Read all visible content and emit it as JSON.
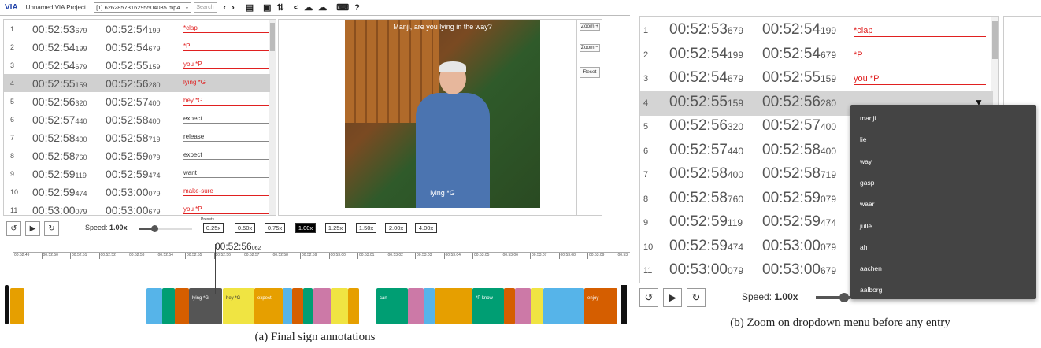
{
  "panel_a": {
    "topbar": {
      "brand": "VIA",
      "project": "Unnamed VIA Project",
      "file": "[1] 6262857316295504035.mp4",
      "search_placeholder": "Search"
    },
    "rows": [
      {
        "idx": "1",
        "s_main": "00:52:53",
        "s_ms": "679",
        "e_main": "00:52:54",
        "e_ms": "199",
        "label": "*clap",
        "red": true
      },
      {
        "idx": "2",
        "s_main": "00:52:54",
        "s_ms": "199",
        "e_main": "00:52:54",
        "e_ms": "679",
        "label": "*P",
        "red": true
      },
      {
        "idx": "3",
        "s_main": "00:52:54",
        "s_ms": "679",
        "e_main": "00:52:55",
        "e_ms": "159",
        "label": "you *P",
        "red": true
      },
      {
        "idx": "4",
        "s_main": "00:52:55",
        "s_ms": "159",
        "e_main": "00:52:56",
        "e_ms": "280",
        "label": "lying *G",
        "red": true
      },
      {
        "idx": "5",
        "s_main": "00:52:56",
        "s_ms": "320",
        "e_main": "00:52:57",
        "e_ms": "400",
        "label": "hey *G",
        "red": true
      },
      {
        "idx": "6",
        "s_main": "00:52:57",
        "s_ms": "440",
        "e_main": "00:52:58",
        "e_ms": "400",
        "label": "expect",
        "red": false
      },
      {
        "idx": "7",
        "s_main": "00:52:58",
        "s_ms": "400",
        "e_main": "00:52:58",
        "e_ms": "719",
        "label": "release",
        "red": false
      },
      {
        "idx": "8",
        "s_main": "00:52:58",
        "s_ms": "760",
        "e_main": "00:52:59",
        "e_ms": "079",
        "label": "expect",
        "red": false
      },
      {
        "idx": "9",
        "s_main": "00:52:59",
        "s_ms": "119",
        "e_main": "00:52:59",
        "e_ms": "474",
        "label": "want",
        "red": false
      },
      {
        "idx": "10",
        "s_main": "00:52:59",
        "s_ms": "474",
        "e_main": "00:53:00",
        "e_ms": "079",
        "label": "make-sure",
        "red": true
      },
      {
        "idx": "11",
        "s_main": "00:53:00",
        "s_ms": "079",
        "e_main": "00:53:00",
        "e_ms": "679",
        "label": "you *P",
        "red": true
      }
    ],
    "selected_row_index": 3,
    "video": {
      "caption_top": "Manji, are you lying in the way?",
      "caption_bottom": "lying *G"
    },
    "zoom": {
      "zoom_in": "Zoom +",
      "zoom_out": "Zoom −",
      "reset": "Reset"
    },
    "controls": {
      "speed_label": "Speed:",
      "speed_value": "1.00x",
      "speed_fraction": 0.3,
      "presets_label": "Presets",
      "presets": [
        "0.25x",
        "0.50x",
        "0.75x",
        "1.00x",
        "1.25x",
        "1.50x",
        "2.00x",
        "4.00x"
      ],
      "active_preset": "1.00x"
    },
    "timeline": {
      "current_main": "00:52:56",
      "current_ms": "062",
      "ticks": [
        "00:52:49",
        "00:52:50",
        "00:52:51",
        "00:52:52",
        "00:52:53",
        "00:52:54",
        "00:52:55",
        "00:52:56",
        "00:52:57",
        "00:52:58",
        "00:52:59",
        "00:53:00",
        "00:53:01",
        "00:53:02",
        "00:53:03",
        "00:53:04",
        "00:53:05",
        "00:53:06",
        "00:53:07",
        "00:53:08",
        "00:53:09",
        "00:53:"
      ],
      "segments": [
        {
          "label": "",
          "color": "#111111"
        },
        {
          "label": "",
          "color": "#e69f00"
        },
        {
          "label": "",
          "color": "#56b4e9"
        },
        {
          "label": "",
          "color": "#009e73"
        },
        {
          "label": "",
          "color": "#d55e00"
        },
        {
          "label": "lying *G",
          "color": "#555555"
        },
        {
          "label": "hey *G",
          "color": "#f0e442"
        },
        {
          "label": "expect",
          "color": "#e69f00"
        },
        {
          "label": "",
          "color": "#56b4e9"
        },
        {
          "label": "",
          "color": "#d55e00"
        },
        {
          "label": "",
          "color": "#009e73"
        },
        {
          "label": "",
          "color": "#cc79a7"
        },
        {
          "label": "",
          "color": "#f0e442"
        },
        {
          "label": "",
          "color": "#e69f00"
        },
        {
          "label": "can",
          "color": "#009e73"
        },
        {
          "label": "",
          "color": "#cc79a7"
        },
        {
          "label": "",
          "color": "#56b4e9"
        },
        {
          "label": "",
          "color": "#e69f00"
        },
        {
          "label": "*P know",
          "color": "#009e73"
        },
        {
          "label": "",
          "color": "#d55e00"
        },
        {
          "label": "",
          "color": "#cc79a7"
        },
        {
          "label": "",
          "color": "#f0e442"
        },
        {
          "label": "",
          "color": "#56b4e9"
        },
        {
          "label": "enjoy",
          "color": "#d55e00"
        }
      ]
    },
    "caption": "(a) Final sign annotations"
  },
  "panel_b": {
    "rows": [
      {
        "idx": "1",
        "s_main": "00:52:53",
        "s_ms": "679",
        "e_main": "00:52:54",
        "e_ms": "199",
        "label": "*clap"
      },
      {
        "idx": "2",
        "s_main": "00:52:54",
        "s_ms": "199",
        "e_main": "00:52:54",
        "e_ms": "679",
        "label": "*P"
      },
      {
        "idx": "3",
        "s_main": "00:52:54",
        "s_ms": "679",
        "e_main": "00:52:55",
        "e_ms": "159",
        "label": "you *P"
      },
      {
        "idx": "4",
        "s_main": "00:52:55",
        "s_ms": "159",
        "e_main": "00:52:56",
        "e_ms": "280",
        "label": ""
      },
      {
        "idx": "5",
        "s_main": "00:52:56",
        "s_ms": "320",
        "e_main": "00:52:57",
        "e_ms": "400",
        "label": ""
      },
      {
        "idx": "6",
        "s_main": "00:52:57",
        "s_ms": "440",
        "e_main": "00:52:58",
        "e_ms": "400",
        "label": ""
      },
      {
        "idx": "7",
        "s_main": "00:52:58",
        "s_ms": "400",
        "e_main": "00:52:58",
        "e_ms": "719",
        "label": ""
      },
      {
        "idx": "8",
        "s_main": "00:52:58",
        "s_ms": "760",
        "e_main": "00:52:59",
        "e_ms": "079",
        "label": ""
      },
      {
        "idx": "9",
        "s_main": "00:52:59",
        "s_ms": "119",
        "e_main": "00:52:59",
        "e_ms": "474",
        "label": ""
      },
      {
        "idx": "10",
        "s_main": "00:52:59",
        "s_ms": "474",
        "e_main": "00:53:00",
        "e_ms": "079",
        "label": ""
      },
      {
        "idx": "11",
        "s_main": "00:53:00",
        "s_ms": "079",
        "e_main": "00:53:00",
        "e_ms": "679",
        "label": ""
      }
    ],
    "selected_row_index": 3,
    "dropdown_options": [
      "manji",
      "lie",
      "way",
      "gasp",
      "waar",
      "julle",
      "ah",
      "aachen",
      "aalborg"
    ],
    "speed_label": "Speed:",
    "speed_value": "1.00x",
    "caption": "(b) Zoom on dropdown menu before any entry"
  },
  "icons": {
    "play": "▶",
    "rewind": "↺",
    "forward": "↻",
    "dropdown": "▼"
  }
}
